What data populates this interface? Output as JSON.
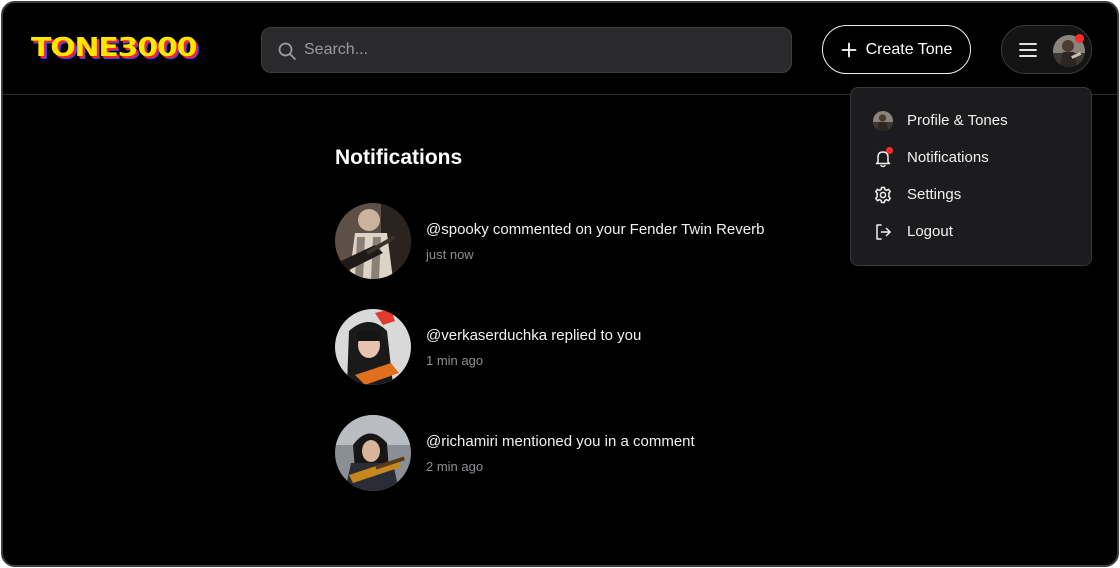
{
  "header": {
    "logo_text": "TONE3000",
    "search": {
      "placeholder": "Search..."
    },
    "create_button_label": "Create Tone"
  },
  "colors": {
    "background": "#000000",
    "notification_dot": "#ff2a2a",
    "logo_yellow": "#ffe600",
    "logo_red": "#ff2020",
    "logo_blue": "#1d4dff"
  },
  "user_menu": {
    "items": [
      {
        "label": "Profile & Tones",
        "icon": "avatar"
      },
      {
        "label": "Notifications",
        "icon": "bell-icon"
      },
      {
        "label": "Settings",
        "icon": "gear-icon"
      },
      {
        "label": "Logout",
        "icon": "logout-icon"
      }
    ]
  },
  "page": {
    "title": "Notifications",
    "notifications": [
      {
        "message": "@spooky commented on your Fender Twin Reverb",
        "time": "just now"
      },
      {
        "message": "@verkaserduchka replied to you",
        "time": "1 min ago"
      },
      {
        "message": "@richamiri mentioned you in a comment",
        "time": "2 min ago"
      }
    ]
  }
}
